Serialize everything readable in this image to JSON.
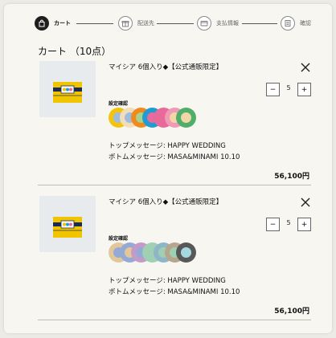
{
  "stepper": {
    "steps": [
      {
        "label": "カート",
        "icon": "bag-icon",
        "active": true
      },
      {
        "label": "配送先",
        "icon": "gift-icon",
        "active": false
      },
      {
        "label": "支払情報",
        "icon": "card-icon",
        "active": false
      },
      {
        "label": "確認",
        "icon": "list-icon",
        "active": false
      }
    ]
  },
  "cart": {
    "title": "カート （10点）"
  },
  "items": [
    {
      "name": "マイシア 6個入り◆【公式通販限定】",
      "quantity": "5",
      "qty_minus": "−",
      "qty_plus": "+",
      "setting_label": "設定確認",
      "colors": [
        {
          "outer": "#f2c40f",
          "inner": "#9dbde0"
        },
        {
          "outer": "#f3ddb8",
          "inner": "#9dbde0"
        },
        {
          "outer": "#f08a1c",
          "inner": "#a7d28e"
        },
        {
          "outer": "#1f9cd4",
          "inner": "#e96b9e"
        },
        {
          "outer": "#e86a9b",
          "inner": "#e86a9b"
        },
        {
          "outer": "#f09ab6",
          "inner": "#f3d6a8"
        },
        {
          "outer": "#4faf6a",
          "inner": "#f3d6a8"
        }
      ],
      "top_message": "トップメッセージ: HAPPY WEDDING",
      "bottom_message": "ボトムメッセージ: MASA&MINAMI 10.10",
      "price": "56,100円"
    },
    {
      "name": "マイシア 6個入り◆【公式通販限定】",
      "quantity": "5",
      "qty_minus": "−",
      "qty_plus": "+",
      "setting_label": "設定確認",
      "colors": [
        {
          "outer": "#e2c79a",
          "inner": "#93a9d6"
        },
        {
          "outer": "#93a9d6",
          "inner": "#e2c79a"
        },
        {
          "outer": "#c49bc8",
          "inner": "#93a9d6"
        },
        {
          "outer": "#9fd0b4",
          "inner": "#9fd0b4"
        },
        {
          "outer": "#8fb6c7",
          "inner": "#9fd0b4"
        },
        {
          "outer": "#b7a58c",
          "inner": "#9fd0b4"
        },
        {
          "outer": "#585858",
          "inner": "#a6d8e0"
        }
      ],
      "top_message": "トップメッセージ: HAPPY WEDDING",
      "bottom_message": "ボトムメッセージ: MASA&MINAMI 10.10",
      "price": "56,100円"
    }
  ]
}
